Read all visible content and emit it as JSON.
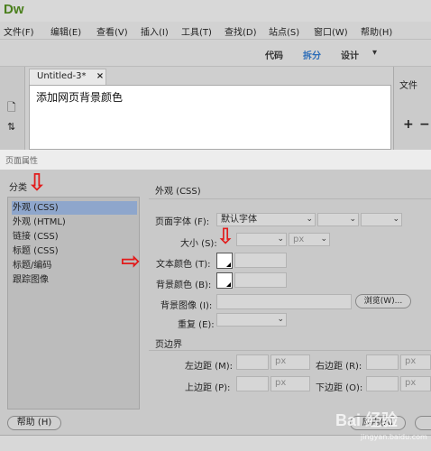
{
  "app": {
    "logo": "Dw"
  },
  "menu": [
    "文件(F)",
    "编辑(E)",
    "查看(V)",
    "插入(I)",
    "工具(T)",
    "查找(D)",
    "站点(S)",
    "窗口(W)",
    "帮助(H)"
  ],
  "view_modes": {
    "code": "代码",
    "split": "拆分",
    "design": "设计",
    "dropdown": "▾"
  },
  "document": {
    "tab_label": "Untitled-3*",
    "tab_close": "×",
    "content": "添加网页背景颜色"
  },
  "right_panel": {
    "tab": "文件",
    "plus": "+",
    "minus": "−"
  },
  "dialog": {
    "title": "页面属性",
    "category_label": "分类",
    "categories": [
      "外观 (CSS)",
      "外观 (HTML)",
      "链接 (CSS)",
      "标题 (CSS)",
      "标题/编码",
      "跟踪图像"
    ],
    "selected_category": "外观 (CSS)",
    "section_title": "外观 (CSS)",
    "page_font_label": "页面字体 (F):",
    "page_font_value": "默认字体",
    "size_label": "大小 (S):",
    "size_unit": "px",
    "text_color_label": "文本颜色 (T):",
    "bg_color_label": "背景颜色 (B):",
    "bg_image_label": "背景图像 (I):",
    "browse_label": "浏览(W)...",
    "repeat_label": "重复 (E):",
    "margins_title": "页边界",
    "left_margin_label": "左边距 (M):",
    "right_margin_label": "右边距 (R):",
    "top_margin_label": "上边距 (P):",
    "bottom_margin_label": "下边距 (O):",
    "margin_unit": "px",
    "help_label": "帮助 (H)",
    "apply_label": "应用(A)"
  },
  "annotations": {
    "arrow_color": "#e21b1b",
    "down_arrow": "⇩",
    "right_arrow": "⇨"
  },
  "watermark": {
    "text": "Bai 经验",
    "url": "jingyan.baidu.com"
  },
  "colors": {
    "selected": "#8ea6cc",
    "logo": "#4a7f1c",
    "split_active": "#2b6cb8"
  }
}
